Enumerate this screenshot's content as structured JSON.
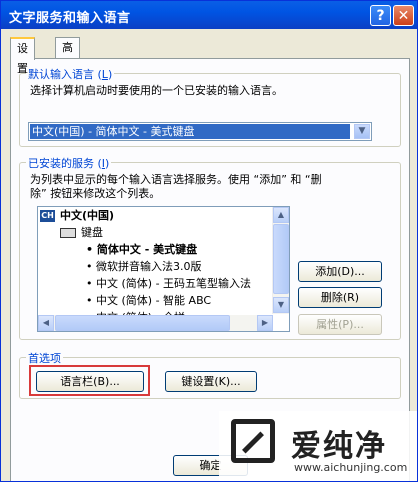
{
  "window": {
    "title": "文字服务和输入语言",
    "help_label": "?",
    "close_label": "✕"
  },
  "tabs": [
    {
      "label": "设置",
      "active": true
    },
    {
      "label": "高级",
      "active": false
    }
  ],
  "default_language": {
    "group_label_prefix": "默认输入语言 (",
    "group_label_key": "L",
    "group_label_suffix": ")",
    "description": "选择计算机启动时要使用的一个已安装的输入语言。",
    "selected_value": "中文(中国) - 简体中文 - 美式键盘",
    "arrow_icon": "chevron-down-icon"
  },
  "installed_services": {
    "group_label_prefix": "已安装的服务 (",
    "group_label_key": "I",
    "group_label_suffix": ")",
    "description_line1": "为列表中显示的每个输入语言选择服务。使用 “添加” 和 “删",
    "description_line2": "除” 按钮来修改这个列表。",
    "tree": {
      "language_badge": "CH",
      "language": "中文(中国)",
      "category": "键盘",
      "items": [
        "简体中文 - 美式键盘",
        "微软拼音输入法3.0版",
        "中文 (简体) - 王码五笔型输入法",
        "中文 (简体) - 智能 ABC",
        "中文 (简体) - 全拼"
      ]
    },
    "buttons": {
      "add": "添加(D)...",
      "remove": "删除(R)",
      "properties": "属性(P)..."
    }
  },
  "preferences": {
    "group_label": "首选项",
    "language_bar_button": "语言栏(B)...",
    "key_settings_button": "键设置(K)..."
  },
  "footer": {
    "ok_button": "确定"
  },
  "watermark": {
    "text": "爱纯净",
    "url": "www.aichunjing.com"
  }
}
